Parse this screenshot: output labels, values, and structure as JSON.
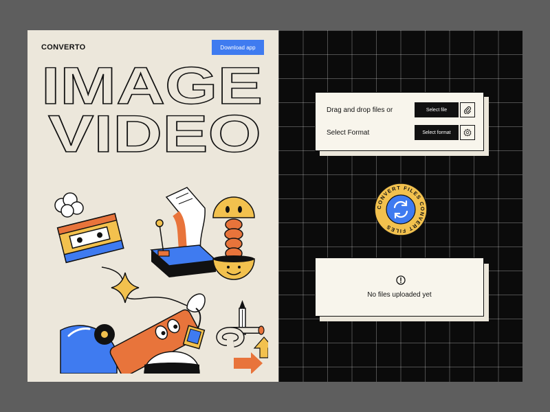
{
  "header": {
    "brand": "CONVERTO",
    "download_label": "Download app"
  },
  "hero": {
    "line1": "IMAGE",
    "line2": "VIDEO"
  },
  "upload_card": {
    "drag_label": "Drag and drop files or",
    "select_file_label": "Select file",
    "format_label": "Select Format",
    "select_format_label": "Select format"
  },
  "convert_badge": {
    "ring_text": "CONVERT FILES CONVERT FILES"
  },
  "empty_state": {
    "message": "No files uploaded yet"
  },
  "icons": {
    "attach": "paperclip-icon",
    "settings": "gear-icon",
    "convert": "refresh-icon",
    "info": "exclamation-circle-icon"
  },
  "colors": {
    "accent_blue": "#3f7bf0",
    "cream": "#ece7db",
    "orange": "#e8743b",
    "yellow": "#f2c14e",
    "dark": "#0b0b0b"
  }
}
